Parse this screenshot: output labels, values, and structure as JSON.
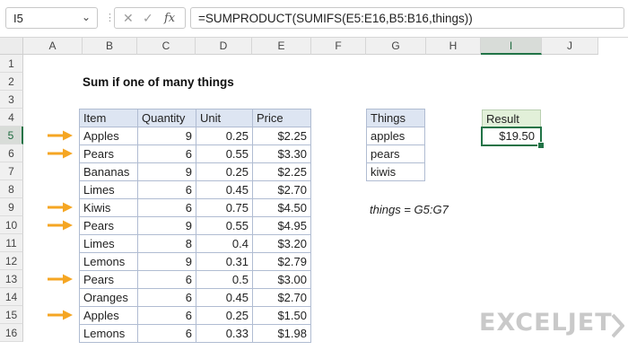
{
  "formula_bar": {
    "name_box": "I5",
    "formula": "=SUMPRODUCT(SUMIFS(E5:E16,B5:B16,things))",
    "fx_label": "fx",
    "separator": "⋮"
  },
  "columns": [
    "A",
    "B",
    "C",
    "D",
    "E",
    "F",
    "G",
    "H",
    "I",
    "J"
  ],
  "rows": [
    "1",
    "2",
    "3",
    "4",
    "5",
    "6",
    "7",
    "8",
    "9",
    "10",
    "11",
    "12",
    "13",
    "14",
    "15",
    "16"
  ],
  "selected_column": "I",
  "selected_row": "5",
  "title": "Sum if one of many things",
  "table": {
    "headers": [
      "Item",
      "Quantity",
      "Unit",
      "Price"
    ],
    "rows": [
      {
        "item": "Apples",
        "qty": "9",
        "unit": "0.25",
        "price": "$2.25",
        "arrow": true
      },
      {
        "item": "Pears",
        "qty": "6",
        "unit": "0.55",
        "price": "$3.30",
        "arrow": true
      },
      {
        "item": "Bananas",
        "qty": "9",
        "unit": "0.25",
        "price": "$2.25",
        "arrow": false
      },
      {
        "item": "Limes",
        "qty": "6",
        "unit": "0.45",
        "price": "$2.70",
        "arrow": false
      },
      {
        "item": "Kiwis",
        "qty": "6",
        "unit": "0.75",
        "price": "$4.50",
        "arrow": true
      },
      {
        "item": "Pears",
        "qty": "9",
        "unit": "0.55",
        "price": "$4.95",
        "arrow": true
      },
      {
        "item": "Limes",
        "qty": "8",
        "unit": "0.4",
        "price": "$3.20",
        "arrow": false
      },
      {
        "item": "Lemons",
        "qty": "9",
        "unit": "0.31",
        "price": "$2.79",
        "arrow": false
      },
      {
        "item": "Pears",
        "qty": "6",
        "unit": "0.5",
        "price": "$3.00",
        "arrow": true
      },
      {
        "item": "Oranges",
        "qty": "6",
        "unit": "0.45",
        "price": "$2.70",
        "arrow": false
      },
      {
        "item": "Apples",
        "qty": "6",
        "unit": "0.25",
        "price": "$1.50",
        "arrow": true
      },
      {
        "item": "Lemons",
        "qty": "6",
        "unit": "0.33",
        "price": "$1.98",
        "arrow": false
      }
    ]
  },
  "things": {
    "header": "Things",
    "items": [
      "apples",
      "pears",
      "kiwis"
    ]
  },
  "result": {
    "header": "Result",
    "value": "$19.50"
  },
  "named_range_note": "things = G5:G7",
  "logo_text": "EXCELJET",
  "colors": {
    "arrow": "#f5a623",
    "table_header": "#dde5f2",
    "result_header": "#e2f0d9",
    "selection": "#217346"
  }
}
